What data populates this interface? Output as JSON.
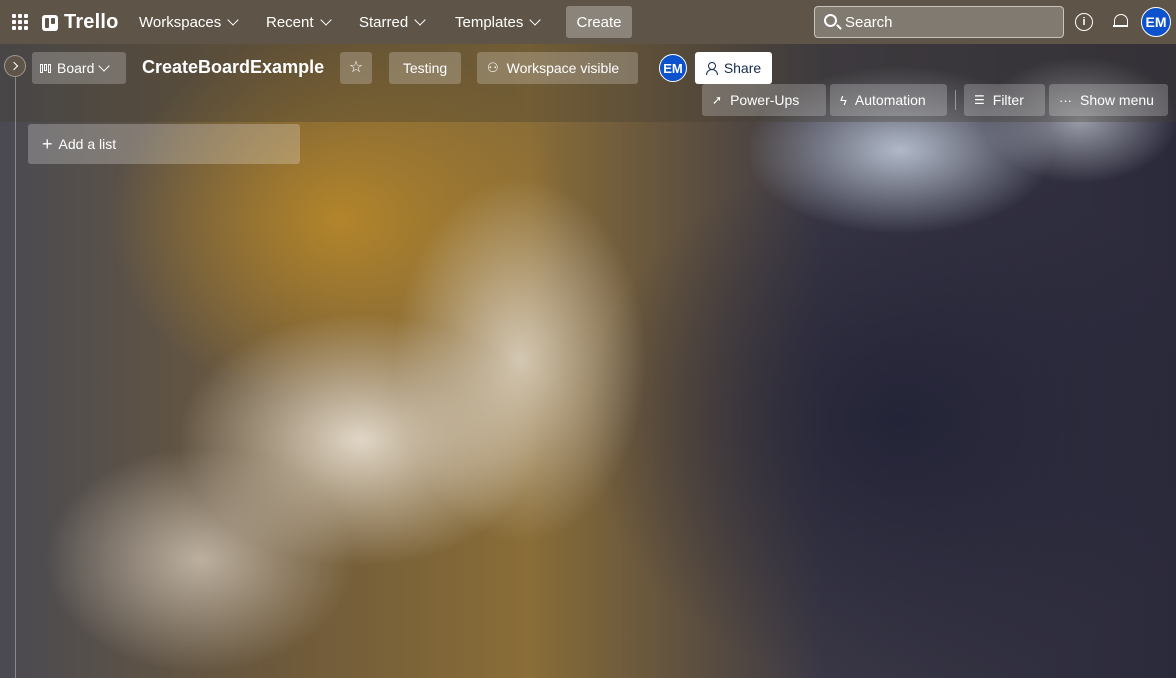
{
  "app": {
    "logo_text": "Trello"
  },
  "topnav": {
    "items": [
      {
        "label": "Workspaces"
      },
      {
        "label": "Recent"
      },
      {
        "label": "Starred"
      },
      {
        "label": "Templates"
      }
    ],
    "create_label": "Create",
    "search_placeholder": "Search",
    "info_glyph": "i",
    "avatar_initials": "EM"
  },
  "board": {
    "view_label": "Board",
    "title": "CreateBoardExample",
    "workspace_label": "Testing",
    "visibility_label": "Workspace visible",
    "member_initials": "EM",
    "share_label": "Share",
    "powerups_label": "Power-Ups",
    "automation_label": "Automation",
    "filter_label": "Filter",
    "show_menu_label": "Show menu",
    "add_list_label": "Add a list"
  },
  "colors": {
    "nav_bg": "#5e5548",
    "avatar_bg": "#0c52cc",
    "share_text": "#172b4d"
  },
  "icons": [
    "apps-grid-icon",
    "trello-logo-icon",
    "chevron-down-icon",
    "search-icon",
    "info-icon",
    "bell-icon",
    "chevron-right-icon",
    "board-view-icon",
    "star-icon",
    "people-icon",
    "person-add-icon",
    "rocket-icon",
    "lightning-icon",
    "filter-icon",
    "ellipsis-icon",
    "plus-icon"
  ]
}
